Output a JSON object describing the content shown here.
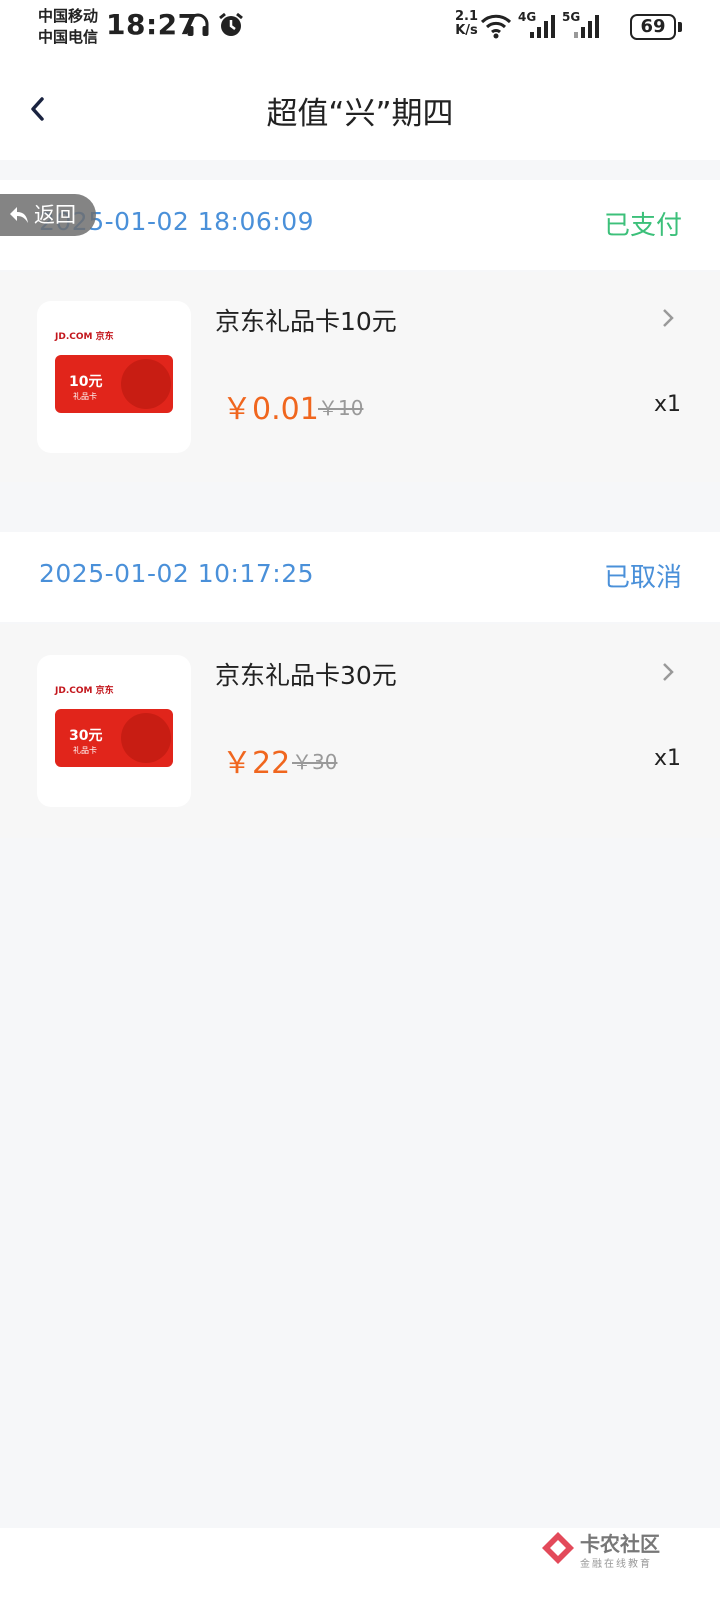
{
  "status_bar": {
    "carrier1": "中国移动",
    "carrier2": "中国电信",
    "time": "18:27",
    "speed_value": "2.1",
    "speed_unit": "K/s",
    "net1": "4G",
    "net2": "5G",
    "battery": "69",
    "icons": [
      "headphones-icon",
      "alarm-icon",
      "wifi-icon",
      "signal-icon",
      "battery-icon"
    ]
  },
  "header": {
    "title": "超值“兴”期四",
    "back_icon": "chevron-left-icon"
  },
  "float_back": {
    "label": "返回",
    "icon": "reply-arrow-icon"
  },
  "orders": [
    {
      "time": "2025-01-02 18:06:09",
      "status": "已支付",
      "status_color": "#3cc07a",
      "product_name": "京东礼品卡10元",
      "price": "￥0.01",
      "original_price": "￥10",
      "quantity": "x1",
      "card_amount": "10元",
      "card_sub": "礼品卡",
      "brand": "JD.COM 京东"
    },
    {
      "time": "2025-01-02 10:17:25",
      "status": "已取消",
      "status_color": "#4a90d9",
      "product_name": "京东礼品卡30元",
      "price": "￥22",
      "original_price": "￥30",
      "quantity": "x1",
      "card_amount": "30元",
      "card_sub": "礼品卡",
      "brand": "JD.COM 京东"
    }
  ],
  "watermark": {
    "title": "卡农社区",
    "subtitle": "金融在线教育"
  },
  "colors": {
    "accent_blue": "#4a90d9",
    "paid_green": "#3cc07a",
    "price_orange": "#f0661e",
    "jd_red": "#e1251b"
  }
}
